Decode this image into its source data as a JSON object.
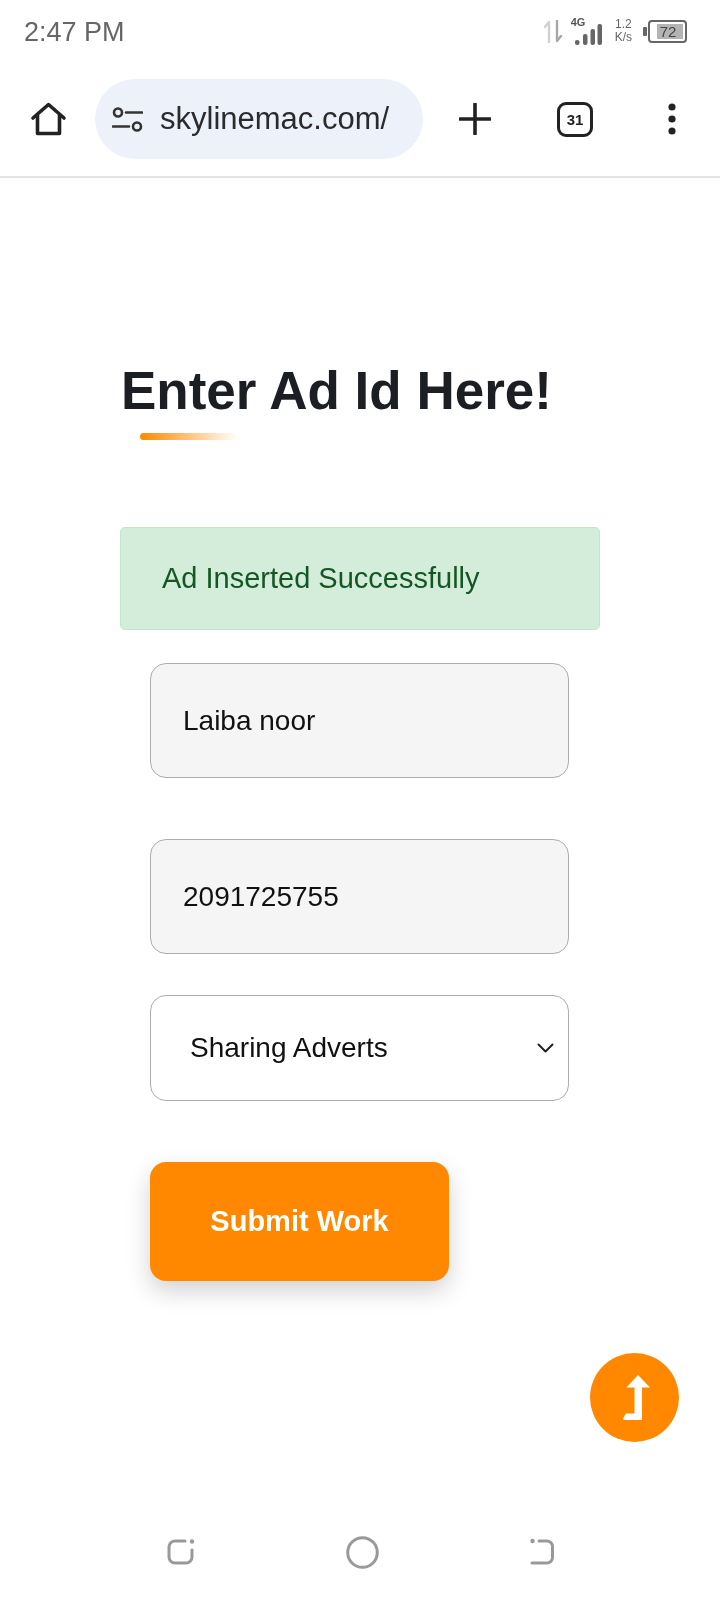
{
  "status_bar": {
    "time": "2:47 PM",
    "network_type": "4G",
    "speed_value": "1.2",
    "speed_unit": "K/s",
    "battery": "72"
  },
  "browser_toolbar": {
    "url": "skylinemac.com/",
    "tab_count": "31"
  },
  "page": {
    "heading": "Enter Ad Id Here!",
    "alert": {
      "kind": "success",
      "text": "Ad Inserted Successfully"
    },
    "fields": [
      {
        "kind": "text",
        "value": "Laiba noor"
      },
      {
        "kind": "text",
        "value": "2091725755"
      },
      {
        "kind": "select",
        "value": "Sharing Adverts"
      }
    ],
    "submit_button": "Submit Work"
  }
}
